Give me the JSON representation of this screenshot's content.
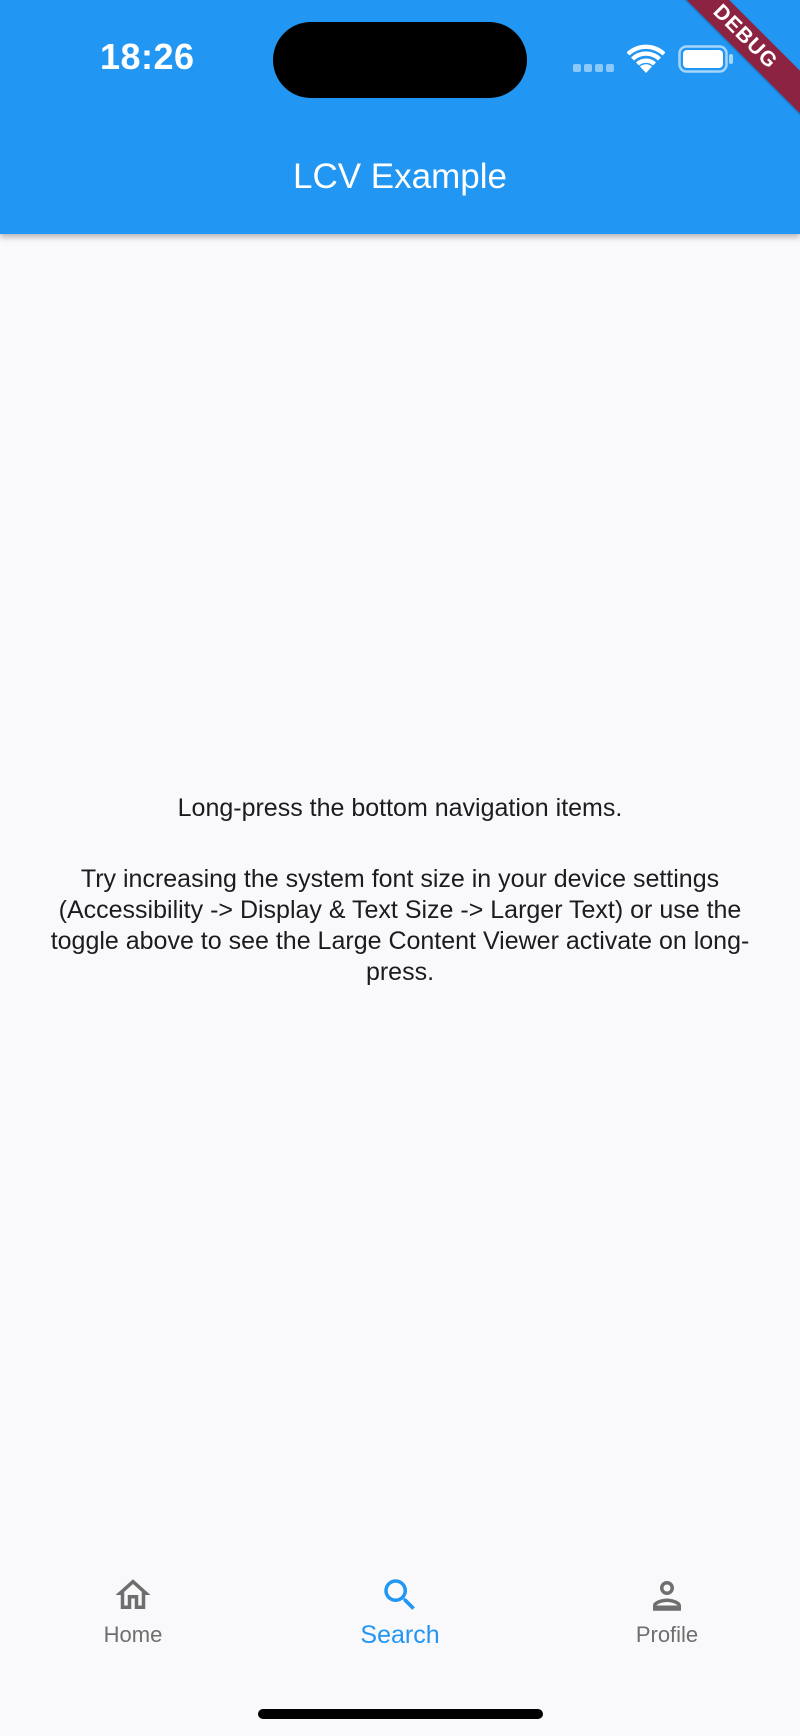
{
  "status_bar": {
    "time": "18:26"
  },
  "debug_banner": "DEBUG",
  "app_bar": {
    "title": "LCV Example",
    "color": "#2196f3"
  },
  "content": {
    "instruction": "Long-press the bottom navigation items.",
    "hint": "Try increasing the system font size in your device settings (Accessibility -> Display & Text Size -> Larger Text) or use the toggle above to see the Large Content Viewer activate on long-press."
  },
  "bottom_nav": {
    "active_color": "#2196f3",
    "inactive_color": "#6e6e6e",
    "items": [
      {
        "label": "Home",
        "icon": "home-icon",
        "active": false
      },
      {
        "label": "Search",
        "icon": "search-icon",
        "active": true
      },
      {
        "label": "Profile",
        "icon": "person-icon",
        "active": false
      }
    ]
  }
}
